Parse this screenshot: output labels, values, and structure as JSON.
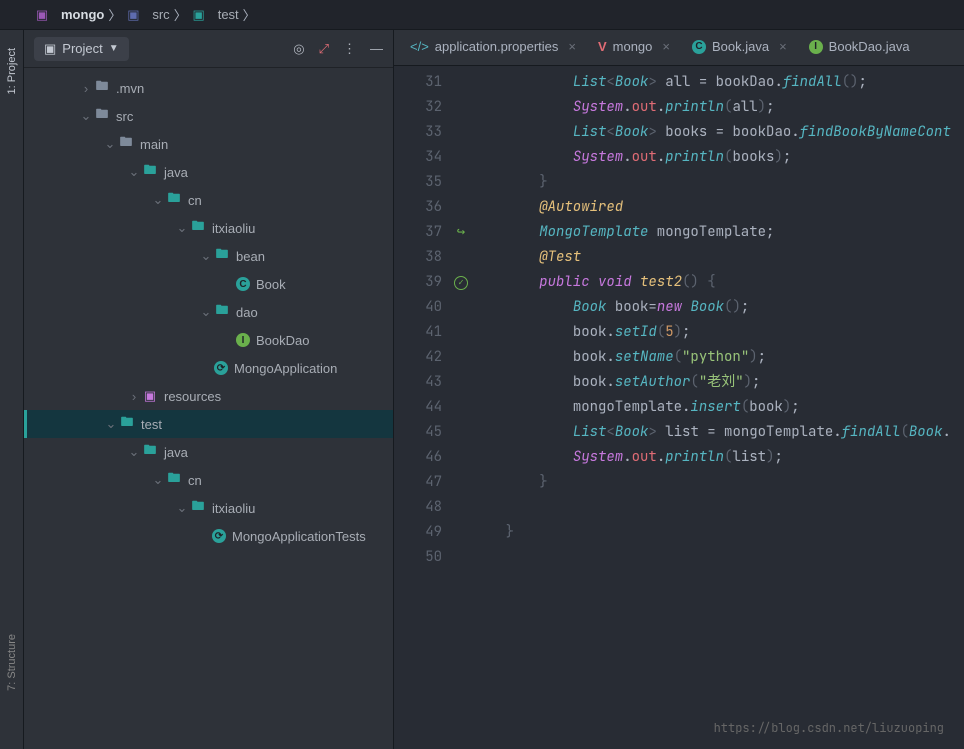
{
  "breadcrumbs": {
    "root": "mongo",
    "mid": "src",
    "leaf": "test"
  },
  "sidebar": {
    "title": "Project"
  },
  "tree": {
    "mvn": ".mvn",
    "src": "src",
    "main": "main",
    "java": "java",
    "cn": "cn",
    "itxiaoliu": "itxiaoliu",
    "bean": "bean",
    "book": "Book",
    "dao": "dao",
    "bookdao": "BookDao",
    "mongoapp": "MongoApplication",
    "resources": "resources",
    "test": "test",
    "java2": "java",
    "cn2": "cn",
    "itxiaoliu2": "itxiaoliu",
    "mat": "MongoApplicationTests"
  },
  "tabs": {
    "t1": "application.properties",
    "t2": "mongo",
    "t3": "Book.java",
    "t4": "BookDao.java"
  },
  "code": {
    "l31a": "List",
    "l31b": "Book",
    "l31c": " all = bookDao.",
    "l31d": "findAll",
    "l32a": "System",
    "l32b": "out",
    "l32c": "println",
    "l32d": "all",
    "l33a": "List",
    "l33b": "Book",
    "l33c": " books = bookDao.",
    "l33d": "findBookByNameCont",
    "l34a": "System",
    "l34b": "out",
    "l34c": "println",
    "l34d": "books",
    "l36": "@Autowired",
    "l37a": "MongoTemplate",
    "l37b": " mongoTemplate",
    "l37c": ";",
    "l38": "@Test",
    "l39a": "public",
    "l39b": "void",
    "l39c": "test2",
    "l40a": "Book",
    "l40b": " book",
    "l40c": "=",
    "l40d": "new",
    "l40e": "Book",
    "l41a": "book.",
    "l41b": "setId",
    "l41c": "5",
    "l42a": "book.",
    "l42b": "setName",
    "l42c": "\"python\"",
    "l43a": "book.",
    "l43b": "setAuthor",
    "l43c": "\"老刘\"",
    "l44a": "mongoTemplate.",
    "l44b": "insert",
    "l44c": "book",
    "l45a": "List",
    "l45b": "Book",
    "l45c": " list = mongoTemplate.",
    "l45d": "findAll",
    "l45e": "Book",
    "l46a": "System",
    "l46b": "out",
    "l46c": "println",
    "l46d": "list"
  },
  "leftRail": {
    "project": "1: Project",
    "structure": "7: Structure"
  },
  "watermark": "https://blog.csdn.net/liuzuoping"
}
